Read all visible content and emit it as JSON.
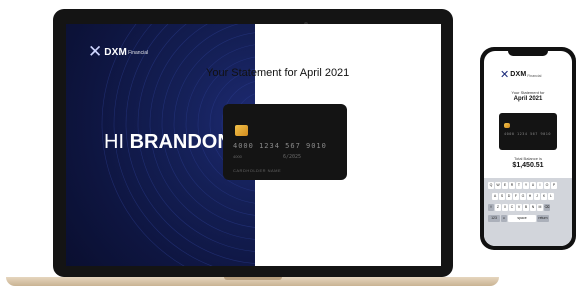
{
  "laptop": {
    "logo": {
      "mark": "✕",
      "brand": "DXM",
      "sub": "Financial"
    },
    "greeting": {
      "prefix": "HI ",
      "name": "BRANDON"
    },
    "statement_title": "Your Statement for April 2021",
    "card": {
      "number": "4000 1234 567 9010",
      "mini": "4000",
      "expiry": "6/2025",
      "holder": "CARDHOLDER NAME"
    }
  },
  "phone": {
    "logo": {
      "mark": "✕",
      "brand": "DXM",
      "sub": "Financial"
    },
    "statement_label": "Your Statement for",
    "statement_month": "April 2021",
    "card": {
      "number": "4000 1234 567 9010"
    },
    "balance_label": "Total Balance is",
    "balance_value": "$1,450.51",
    "keyboard": {
      "row1": [
        "Q",
        "W",
        "E",
        "R",
        "T",
        "Y",
        "U",
        "I",
        "O",
        "P"
      ],
      "row2": [
        "A",
        "S",
        "D",
        "F",
        "G",
        "H",
        "J",
        "K",
        "L"
      ],
      "row3": [
        "⇧",
        "Z",
        "X",
        "C",
        "V",
        "B",
        "N",
        "M",
        "⌫"
      ],
      "row4": [
        "123",
        "☺",
        "space",
        "return"
      ]
    }
  },
  "colors": {
    "laptop_panel": "#141f55",
    "card": "#141414",
    "chip": "#e3a83a",
    "bezel": "#141414",
    "base": "#d8c4a6"
  }
}
